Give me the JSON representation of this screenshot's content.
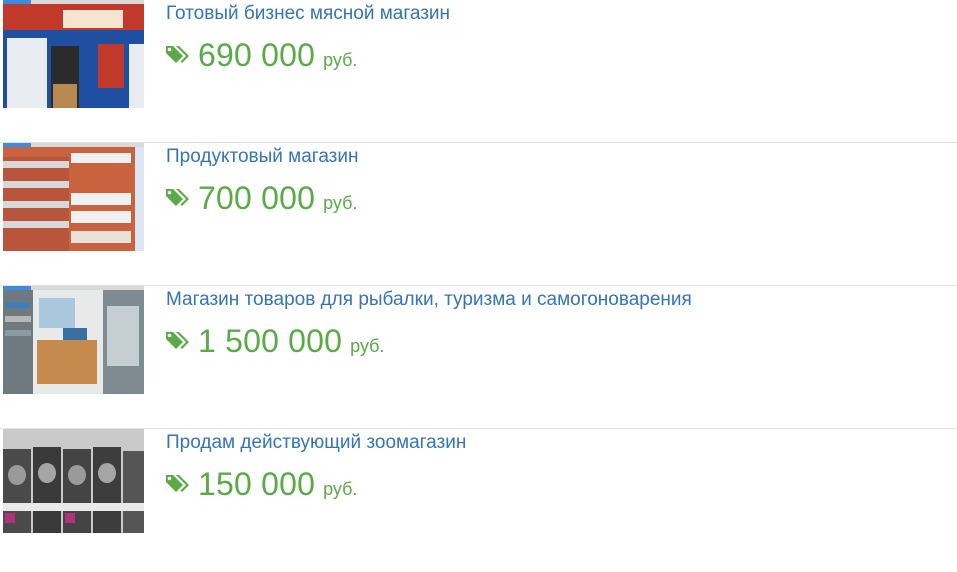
{
  "listings": [
    {
      "title": "Готовый бизнес мясной магазин",
      "price": "690 000",
      "currency": "руб.",
      "image": "meat-shop-storefront"
    },
    {
      "title": "Продуктовый магазин",
      "price": "700 000",
      "currency": "руб.",
      "image": "apartment-building"
    },
    {
      "title": "Магазин товаров для рыбалки, туризма и самогоноварения",
      "price": "1 500 000",
      "currency": "руб.",
      "image": "fishing-store-interior"
    },
    {
      "title": "Продам действующий зоомагазин",
      "price": "150 000",
      "currency": "руб.",
      "image": "pet-food-shelf"
    }
  ],
  "icons": {
    "price": "tags-icon"
  },
  "colors": {
    "title": "#3474b7",
    "price": "#5aab47",
    "gallery_indicator": "#3b8be0"
  },
  "gallery_progress": 0.2
}
